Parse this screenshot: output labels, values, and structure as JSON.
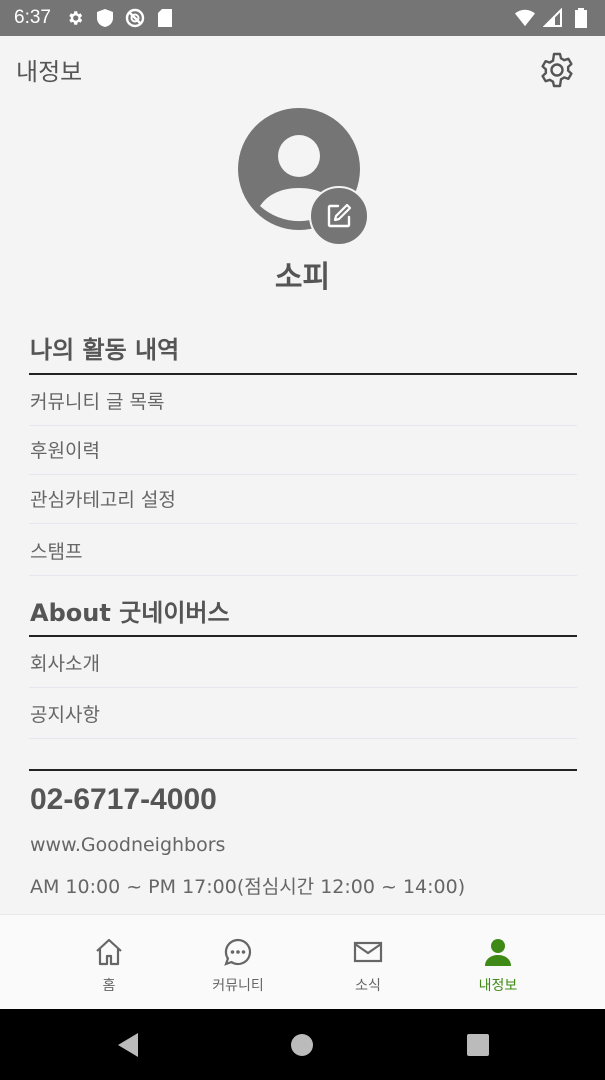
{
  "status_bar": {
    "time": "6:37",
    "icons_left": [
      "settings-icon",
      "shield-icon",
      "no-disturb-icon",
      "sd-card-icon"
    ],
    "icons_right": [
      "wifi-icon",
      "signal-icon",
      "battery-icon"
    ],
    "background": "#757575"
  },
  "header": {
    "title": "내정보"
  },
  "profile": {
    "name": "소피"
  },
  "sections": {
    "activity": {
      "title": "나의 활동 내역",
      "items": [
        "커뮤니티 글 목록",
        "후원이력",
        "관심카테고리 설정",
        "스탬프"
      ]
    },
    "about": {
      "title": "About 굿네이버스",
      "items": [
        "회사소개",
        "공지사항"
      ]
    }
  },
  "contact": {
    "phone": "02-6717-4000",
    "website": "www.Goodneighbors",
    "hours": "AM 10:00 ~ PM 17:00(점심시간 12:00 ~ 14:00)"
  },
  "bottom_nav": {
    "items": [
      {
        "label": "홈",
        "icon": "home-icon"
      },
      {
        "label": "커뮤니티",
        "icon": "chat-icon"
      },
      {
        "label": "소식",
        "icon": "mail-icon"
      },
      {
        "label": "내정보",
        "icon": "person-icon",
        "active": true
      }
    ],
    "active_color": "#3f8a17"
  }
}
